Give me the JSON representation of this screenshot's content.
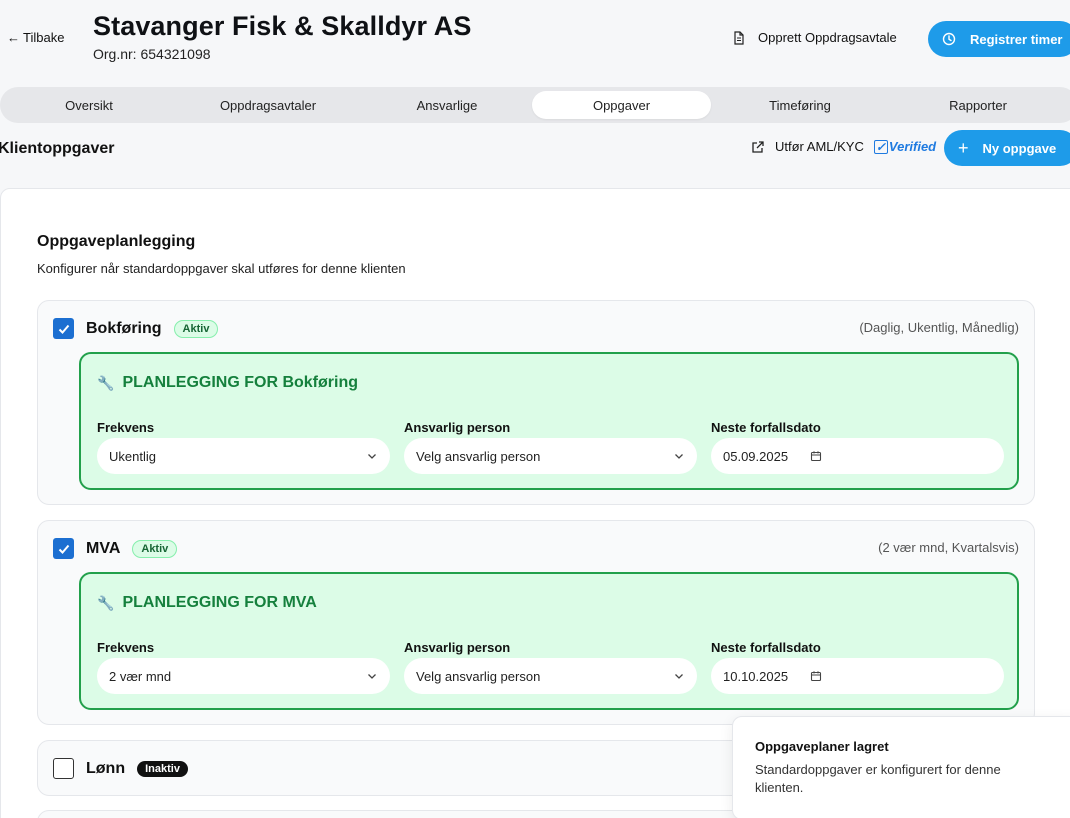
{
  "header": {
    "back_label": "Tilbake",
    "client_name": "Stavanger Fisk & Skalldyr AS",
    "org_nr": "Org.nr: 654321098",
    "create_contract_label": "Opprett Oppdragsavtale",
    "register_hours_label": "Registrer timer"
  },
  "tabs": [
    {
      "label": "Oversikt",
      "active": false
    },
    {
      "label": "Oppdragsavtaler",
      "active": false
    },
    {
      "label": "Ansvarlige",
      "active": false
    },
    {
      "label": "Oppgaver",
      "active": true
    },
    {
      "label": "Timeføring",
      "active": false
    },
    {
      "label": "Rapporter",
      "active": false
    }
  ],
  "section": {
    "title": "Klientoppgaver",
    "aml_label": "Utfør AML/KYC",
    "verified_label": "Verified",
    "new_task_label": "Ny oppgave"
  },
  "panel": {
    "title": "Oppgaveplanlegging",
    "subtitle": "Konfigurer når standardoppgaver skal utføres for denne klienten"
  },
  "tasks": [
    {
      "name": "Bokføring",
      "checked": true,
      "status": "Aktiv",
      "hint": "(Daglig, Ukentlig, Månedlig)",
      "plan_title": "PLANLEGGING FOR Bokføring",
      "frequency_label": "Frekvens",
      "frequency_value": "Ukentlig",
      "responsible_label": "Ansvarlig person",
      "responsible_value": "Velg ansvarlig person",
      "due_label": "Neste forfallsdato",
      "due_value": "05.09.2025"
    },
    {
      "name": "MVA",
      "checked": true,
      "status": "Aktiv",
      "hint": "(2 vær mnd, Kvartalsvis)",
      "plan_title": "PLANLEGGING FOR MVA",
      "frequency_label": "Frekvens",
      "frequency_value": "2 vær mnd",
      "responsible_label": "Ansvarlig person",
      "responsible_value": "Velg ansvarlig person",
      "due_label": "Neste forfallsdato",
      "due_value": "10.10.2025"
    },
    {
      "name": "Lønn",
      "checked": false,
      "status": "Inaktiv"
    }
  ],
  "toast": {
    "title": "Oppgaveplaner lagret",
    "message": "Standardoppgaver er konfigurert for denne klienten."
  },
  "colors": {
    "primary": "#1e9be9",
    "checkbox": "#1c6fd1",
    "plan_bg": "#dcfce7",
    "plan_border": "#22a04b",
    "plan_title": "#15803d"
  }
}
